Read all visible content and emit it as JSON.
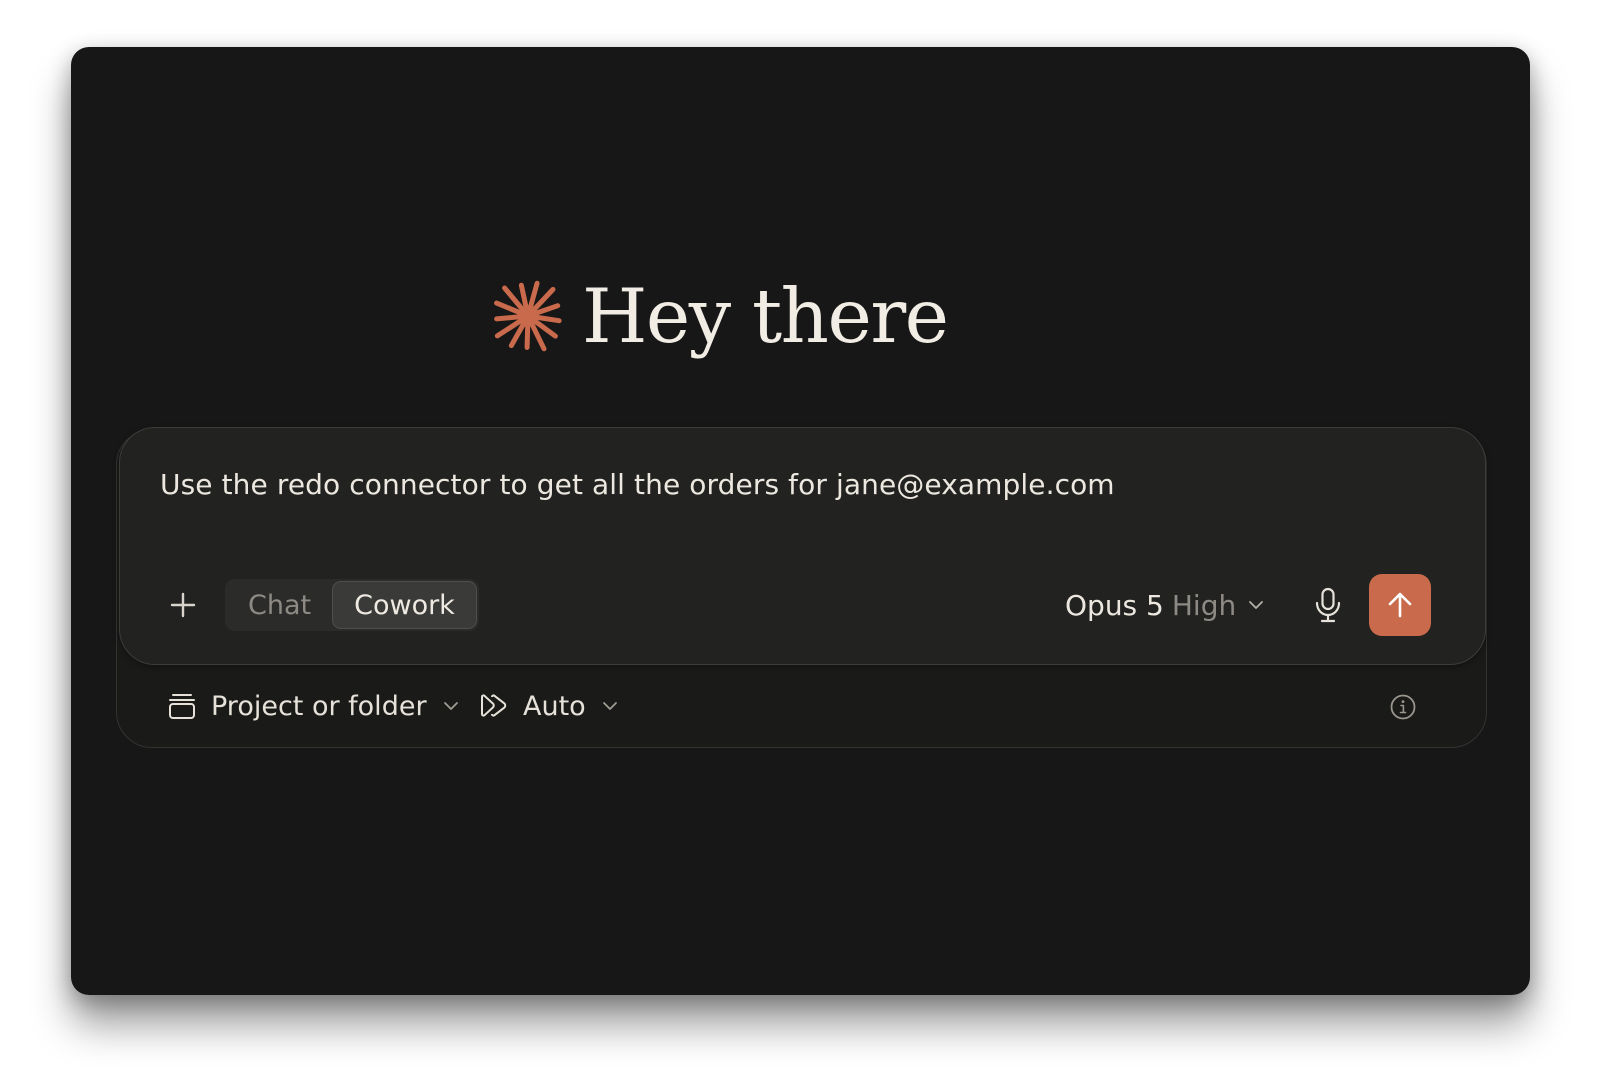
{
  "greeting": {
    "logo_icon": "asterisk-burst-icon",
    "title": "Hey there"
  },
  "composer": {
    "input_value": "Use the redo connector to get all the orders for jane@example.com",
    "add_icon": "plus-icon",
    "modes": [
      {
        "label": "Chat",
        "active": false
      },
      {
        "label": "Cowork",
        "active": true
      }
    ],
    "model": {
      "name": "Opus 5",
      "effort": "High",
      "icon": "chevron-down-icon"
    },
    "mic_icon": "microphone-icon",
    "send_icon": "arrow-up-icon"
  },
  "footer": {
    "project_label": "Project or folder",
    "project_icon": "folder-stack-icon",
    "auto_label": "Auto",
    "auto_icon": "fast-forward-icon",
    "info_icon": "info-icon"
  },
  "colors": {
    "accent": "#c96a4c",
    "window_bg": "#171717",
    "composer_bg": "#222221",
    "text_primary": "#ece8df",
    "text_muted": "#8d8a84"
  }
}
